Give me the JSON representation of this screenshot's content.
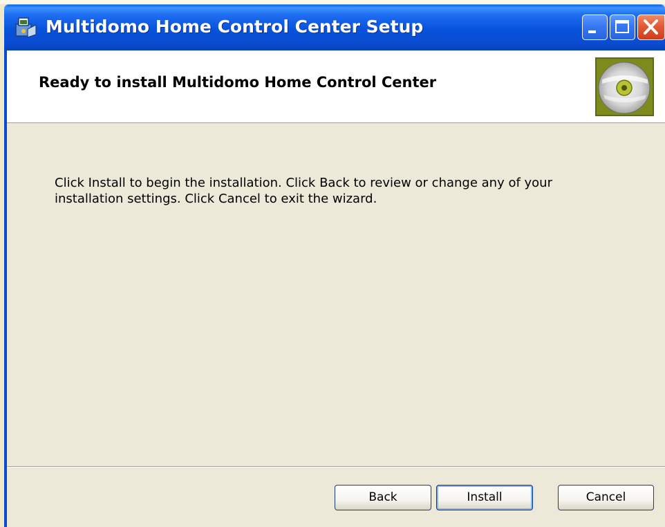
{
  "window": {
    "title": "Multidomo Home Control Center Setup"
  },
  "banner": {
    "heading": "Ready to install Multidomo Home Control Center",
    "icon": "cd-disc-icon"
  },
  "content": {
    "instructions": "Click Install to begin the installation. Click Back to review or change any of your installation settings. Click Cancel to exit the wizard."
  },
  "buttons": {
    "back": "Back",
    "install": "Install",
    "cancel": "Cancel"
  },
  "colors": {
    "titlebar": "#0a4cd0",
    "dialog_bg": "#ece9d8",
    "close_button": "#e25a36",
    "banner_icon_frame": "#7d8a1c"
  }
}
